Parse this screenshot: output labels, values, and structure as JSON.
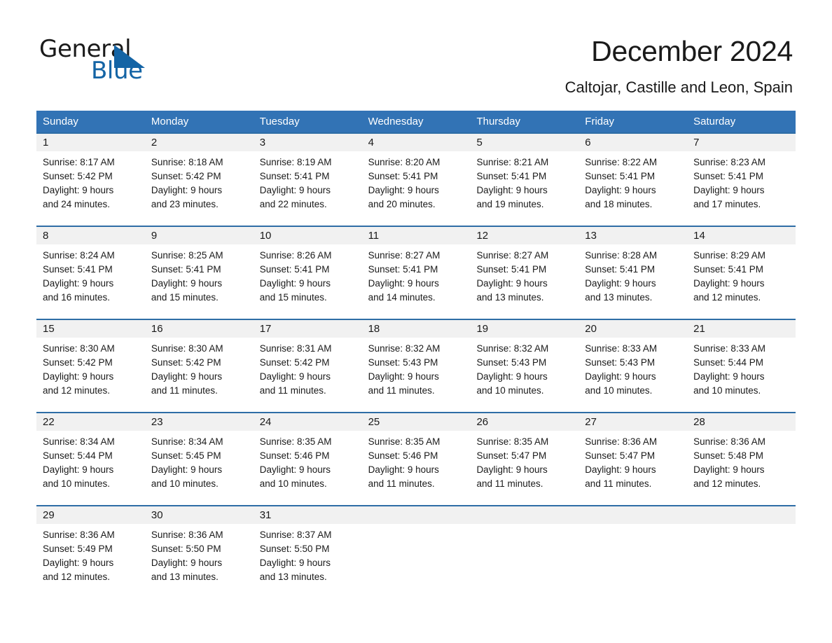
{
  "brand": {
    "name_part1": "General",
    "name_part2": "Blue",
    "logo_icon": "triangle-logo-icon",
    "accent_color": "#1464a5"
  },
  "header": {
    "title": "December 2024",
    "subtitle": "Caltojar, Castille and Leon, Spain"
  },
  "theme": {
    "header_row_bg": "#3273b5",
    "week_divider": "#2e6da6",
    "day_band_bg": "#f1f1f1"
  },
  "weekdays": [
    "Sunday",
    "Monday",
    "Tuesday",
    "Wednesday",
    "Thursday",
    "Friday",
    "Saturday"
  ],
  "weeks": [
    [
      {
        "day": "1",
        "sunrise": "Sunrise: 8:17 AM",
        "sunset": "Sunset: 5:42 PM",
        "daylight1": "Daylight: 9 hours",
        "daylight2": "and 24 minutes."
      },
      {
        "day": "2",
        "sunrise": "Sunrise: 8:18 AM",
        "sunset": "Sunset: 5:42 PM",
        "daylight1": "Daylight: 9 hours",
        "daylight2": "and 23 minutes."
      },
      {
        "day": "3",
        "sunrise": "Sunrise: 8:19 AM",
        "sunset": "Sunset: 5:41 PM",
        "daylight1": "Daylight: 9 hours",
        "daylight2": "and 22 minutes."
      },
      {
        "day": "4",
        "sunrise": "Sunrise: 8:20 AM",
        "sunset": "Sunset: 5:41 PM",
        "daylight1": "Daylight: 9 hours",
        "daylight2": "and 20 minutes."
      },
      {
        "day": "5",
        "sunrise": "Sunrise: 8:21 AM",
        "sunset": "Sunset: 5:41 PM",
        "daylight1": "Daylight: 9 hours",
        "daylight2": "and 19 minutes."
      },
      {
        "day": "6",
        "sunrise": "Sunrise: 8:22 AM",
        "sunset": "Sunset: 5:41 PM",
        "daylight1": "Daylight: 9 hours",
        "daylight2": "and 18 minutes."
      },
      {
        "day": "7",
        "sunrise": "Sunrise: 8:23 AM",
        "sunset": "Sunset: 5:41 PM",
        "daylight1": "Daylight: 9 hours",
        "daylight2": "and 17 minutes."
      }
    ],
    [
      {
        "day": "8",
        "sunrise": "Sunrise: 8:24 AM",
        "sunset": "Sunset: 5:41 PM",
        "daylight1": "Daylight: 9 hours",
        "daylight2": "and 16 minutes."
      },
      {
        "day": "9",
        "sunrise": "Sunrise: 8:25 AM",
        "sunset": "Sunset: 5:41 PM",
        "daylight1": "Daylight: 9 hours",
        "daylight2": "and 15 minutes."
      },
      {
        "day": "10",
        "sunrise": "Sunrise: 8:26 AM",
        "sunset": "Sunset: 5:41 PM",
        "daylight1": "Daylight: 9 hours",
        "daylight2": "and 15 minutes."
      },
      {
        "day": "11",
        "sunrise": "Sunrise: 8:27 AM",
        "sunset": "Sunset: 5:41 PM",
        "daylight1": "Daylight: 9 hours",
        "daylight2": "and 14 minutes."
      },
      {
        "day": "12",
        "sunrise": "Sunrise: 8:27 AM",
        "sunset": "Sunset: 5:41 PM",
        "daylight1": "Daylight: 9 hours",
        "daylight2": "and 13 minutes."
      },
      {
        "day": "13",
        "sunrise": "Sunrise: 8:28 AM",
        "sunset": "Sunset: 5:41 PM",
        "daylight1": "Daylight: 9 hours",
        "daylight2": "and 13 minutes."
      },
      {
        "day": "14",
        "sunrise": "Sunrise: 8:29 AM",
        "sunset": "Sunset: 5:41 PM",
        "daylight1": "Daylight: 9 hours",
        "daylight2": "and 12 minutes."
      }
    ],
    [
      {
        "day": "15",
        "sunrise": "Sunrise: 8:30 AM",
        "sunset": "Sunset: 5:42 PM",
        "daylight1": "Daylight: 9 hours",
        "daylight2": "and 12 minutes."
      },
      {
        "day": "16",
        "sunrise": "Sunrise: 8:30 AM",
        "sunset": "Sunset: 5:42 PM",
        "daylight1": "Daylight: 9 hours",
        "daylight2": "and 11 minutes."
      },
      {
        "day": "17",
        "sunrise": "Sunrise: 8:31 AM",
        "sunset": "Sunset: 5:42 PM",
        "daylight1": "Daylight: 9 hours",
        "daylight2": "and 11 minutes."
      },
      {
        "day": "18",
        "sunrise": "Sunrise: 8:32 AM",
        "sunset": "Sunset: 5:43 PM",
        "daylight1": "Daylight: 9 hours",
        "daylight2": "and 11 minutes."
      },
      {
        "day": "19",
        "sunrise": "Sunrise: 8:32 AM",
        "sunset": "Sunset: 5:43 PM",
        "daylight1": "Daylight: 9 hours",
        "daylight2": "and 10 minutes."
      },
      {
        "day": "20",
        "sunrise": "Sunrise: 8:33 AM",
        "sunset": "Sunset: 5:43 PM",
        "daylight1": "Daylight: 9 hours",
        "daylight2": "and 10 minutes."
      },
      {
        "day": "21",
        "sunrise": "Sunrise: 8:33 AM",
        "sunset": "Sunset: 5:44 PM",
        "daylight1": "Daylight: 9 hours",
        "daylight2": "and 10 minutes."
      }
    ],
    [
      {
        "day": "22",
        "sunrise": "Sunrise: 8:34 AM",
        "sunset": "Sunset: 5:44 PM",
        "daylight1": "Daylight: 9 hours",
        "daylight2": "and 10 minutes."
      },
      {
        "day": "23",
        "sunrise": "Sunrise: 8:34 AM",
        "sunset": "Sunset: 5:45 PM",
        "daylight1": "Daylight: 9 hours",
        "daylight2": "and 10 minutes."
      },
      {
        "day": "24",
        "sunrise": "Sunrise: 8:35 AM",
        "sunset": "Sunset: 5:46 PM",
        "daylight1": "Daylight: 9 hours",
        "daylight2": "and 10 minutes."
      },
      {
        "day": "25",
        "sunrise": "Sunrise: 8:35 AM",
        "sunset": "Sunset: 5:46 PM",
        "daylight1": "Daylight: 9 hours",
        "daylight2": "and 11 minutes."
      },
      {
        "day": "26",
        "sunrise": "Sunrise: 8:35 AM",
        "sunset": "Sunset: 5:47 PM",
        "daylight1": "Daylight: 9 hours",
        "daylight2": "and 11 minutes."
      },
      {
        "day": "27",
        "sunrise": "Sunrise: 8:36 AM",
        "sunset": "Sunset: 5:47 PM",
        "daylight1": "Daylight: 9 hours",
        "daylight2": "and 11 minutes."
      },
      {
        "day": "28",
        "sunrise": "Sunrise: 8:36 AM",
        "sunset": "Sunset: 5:48 PM",
        "daylight1": "Daylight: 9 hours",
        "daylight2": "and 12 minutes."
      }
    ],
    [
      {
        "day": "29",
        "sunrise": "Sunrise: 8:36 AM",
        "sunset": "Sunset: 5:49 PM",
        "daylight1": "Daylight: 9 hours",
        "daylight2": "and 12 minutes."
      },
      {
        "day": "30",
        "sunrise": "Sunrise: 8:36 AM",
        "sunset": "Sunset: 5:50 PM",
        "daylight1": "Daylight: 9 hours",
        "daylight2": "and 13 minutes."
      },
      {
        "day": "31",
        "sunrise": "Sunrise: 8:37 AM",
        "sunset": "Sunset: 5:50 PM",
        "daylight1": "Daylight: 9 hours",
        "daylight2": "and 13 minutes."
      },
      {
        "day": "",
        "sunrise": "",
        "sunset": "",
        "daylight1": "",
        "daylight2": ""
      },
      {
        "day": "",
        "sunrise": "",
        "sunset": "",
        "daylight1": "",
        "daylight2": ""
      },
      {
        "day": "",
        "sunrise": "",
        "sunset": "",
        "daylight1": "",
        "daylight2": ""
      },
      {
        "day": "",
        "sunrise": "",
        "sunset": "",
        "daylight1": "",
        "daylight2": ""
      }
    ]
  ]
}
